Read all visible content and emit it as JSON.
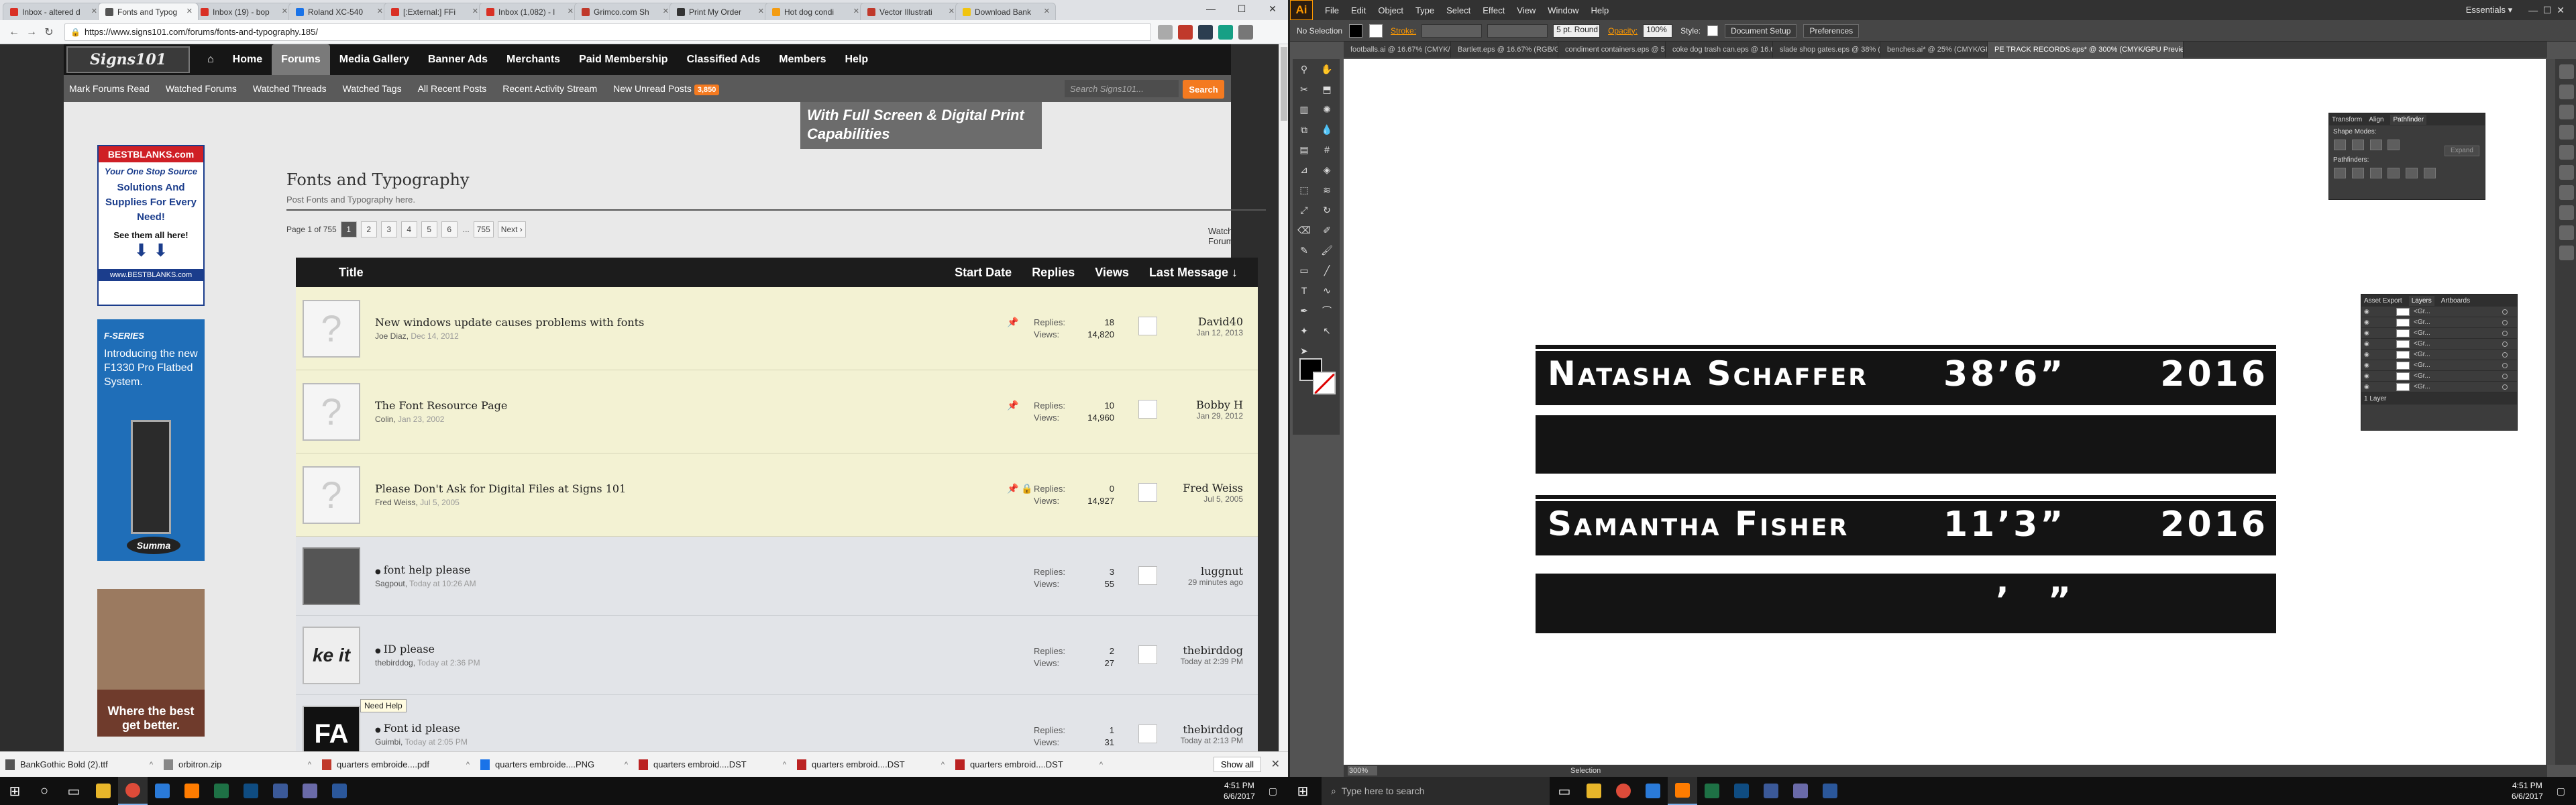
{
  "chrome": {
    "tabs": [
      {
        "label": "Inbox - altered d",
        "fav": "#d93025"
      },
      {
        "label": "Fonts and Typog",
        "fav": "#555555",
        "active": true
      },
      {
        "label": "Inbox (19) - bop",
        "fav": "#d93025"
      },
      {
        "label": "Roland XC-540",
        "fav": "#1a73e8"
      },
      {
        "label": "[:External:] FFi",
        "fav": "#d93025"
      },
      {
        "label": "Inbox (1,082) - l",
        "fav": "#d93025"
      },
      {
        "label": "Grimco.com Sh",
        "fav": "#c0392b"
      },
      {
        "label": "Print My Order",
        "fav": "#333333"
      },
      {
        "label": "Hot dog condi",
        "fav": "#f39c12"
      },
      {
        "label": "Vector Illustrati",
        "fav": "#c0392b"
      },
      {
        "label": "Download Bank",
        "fav": "#f1c40f"
      }
    ],
    "url": "https://www.signs101.com/forums/fonts-and-typography.185/",
    "downloads": [
      "BankGothic Bold (2).ttf",
      "orbitron.zip",
      "quarters embroide....pdf",
      "quarters embroide....PNG",
      "quarters embroid....DST",
      "quarters embroid....DST",
      "quarters embroid....DST"
    ],
    "show_all": "Show all"
  },
  "site": {
    "logo": "Signs101",
    "nav": [
      "Home",
      "Forums",
      "Media Gallery",
      "Banner Ads",
      "Merchants",
      "Paid Membership",
      "Classified Ads",
      "Members",
      "Help"
    ],
    "subnav": [
      "Mark Forums Read",
      "Watched Forums",
      "Watched Threads",
      "Watched Tags",
      "All Recent Posts",
      "Recent Activity Stream",
      "New Unread Posts"
    ],
    "unread_badge": "3,850",
    "search_placeholder": "Search Signs101...",
    "search_button": "Search",
    "banner_text": "With Full Screen & Digital Print Capabilities",
    "forum_title": "Fonts and Typography",
    "forum_subtitle": "Post Fonts and Typography here.",
    "pager_label": "Page 1 of 755",
    "pages": [
      "1",
      "2",
      "3",
      "4",
      "5",
      "6",
      "...",
      "755",
      "Next ›"
    ],
    "watch_forum": "Watch Forum",
    "col_title": "Title",
    "col_start": "Start Date",
    "col_replies": "Replies",
    "col_views": "Views",
    "col_last": "Last Message ↓",
    "replies_label": "Replies:",
    "views_label": "Views:",
    "threads": [
      {
        "title": "New windows update causes problems with fonts",
        "author": "Joe Diaz",
        "date": "Dec 14, 2012",
        "replies": "18",
        "views": "14,820",
        "last_user": "David40",
        "last_time": "Jan 12, 2013",
        "sticky": true
      },
      {
        "title": "The Font Resource Page",
        "author": "Colin",
        "date": "Jan 23, 2002",
        "replies": "10",
        "views": "14,960",
        "last_user": "Bobby H",
        "last_time": "Jan 29, 2012",
        "sticky": true
      },
      {
        "title": "Please Don't Ask for Digital Files at Signs 101",
        "author": "Fred Weiss",
        "date": "Jul 5, 2005",
        "replies": "0",
        "views": "14,927",
        "last_user": "Fred Weiss",
        "last_time": "Jul 5, 2005",
        "sticky": true
      },
      {
        "title": "font help please",
        "author": "Sagpout",
        "date": "Today at 10:26 AM",
        "replies": "3",
        "views": "55",
        "last_user": "luggnut",
        "last_time": "29 minutes ago",
        "sticky": false
      },
      {
        "title": "ID please",
        "author": "thebirddog",
        "date": "Today at 2:36 PM",
        "replies": "2",
        "views": "27",
        "last_user": "thebirddog",
        "last_time": "Today at 2:39 PM",
        "sticky": false
      },
      {
        "title": "Font id please",
        "author": "Guimbi",
        "date": "Today at 2:05 PM",
        "replies": "1",
        "views": "31",
        "last_user": "thebirddog",
        "last_time": "Today at 2:13 PM",
        "sticky": false
      }
    ],
    "tooltip": "Need Help",
    "ad1": {
      "header": "BESTBLANKS.com",
      "line1": "Your One Stop Source",
      "line2": "Solutions And Supplies For Every Need!",
      "line3": "See them all here!",
      "footer": "www.BESTBLANKS.com"
    },
    "ad2": {
      "series": "F-SERIES",
      "text": "Introducing the new F1330 Pro Flatbed System.",
      "brand": "Summa"
    },
    "ad3": {
      "text": "Where the best get better."
    }
  },
  "illustrator": {
    "menu": [
      "File",
      "Edit",
      "Object",
      "Type",
      "Select",
      "Effect",
      "View",
      "Window",
      "Help"
    ],
    "essentials": "Essentials ▾",
    "ctrl": {
      "selection": "No Selection",
      "stroke_label": "Stroke:",
      "brush": "5 pt. Round",
      "opacity_label": "Opacity:",
      "opacity": "100%",
      "style_label": "Style:",
      "doc_setup": "Document Setup",
      "prefs": "Preferences"
    },
    "doc_tabs": [
      "footballs.ai @ 16.67% (CMYK/GPU P...",
      "Bartlett.eps @ 16.67% (RGB/GPU Pre...",
      "condiment containers.eps @ 50% (C...",
      "coke dog trash can.eps @ 16.67% (...",
      "slade shop gates.eps @ 38% (CMYK/...",
      "benches.ai* @ 25% (CMYK/GPU Pre...",
      "PE TRACK RECORDS.eps* @ 300% (CMYK/GPU Preview)"
    ],
    "pathfinder": {
      "tabs": [
        "Transform",
        "Align",
        "Pathfinder"
      ],
      "shape_modes": "Shape Modes:",
      "pathfinders": "Pathfinders:",
      "expand": "Expand"
    },
    "layers": {
      "tabs": [
        "Asset Export",
        "Layers",
        "Artboards"
      ],
      "footer": "1 Layer",
      "rows": [
        "<Gr...",
        "<Gr...",
        "<Gr...",
        "<Gr...",
        "<Gr...",
        "<Gr...",
        "<Gr...",
        "<Gr..."
      ]
    },
    "artwork": [
      {
        "name": "Natasha Schaffer",
        "measure": "38’6”",
        "year": "2016"
      },
      {
        "name": "",
        "measure": "",
        "year": ""
      },
      {
        "name": "Samantha Fisher",
        "measure": "11’3”",
        "year": "2016"
      },
      {
        "name": "",
        "measure": "’ ”",
        "year": ""
      }
    ],
    "zoom": "300%",
    "status": "Selection"
  },
  "taskbar": {
    "left_time": "4:51 PM",
    "left_date": "6/6/2017",
    "right_time": "4:51 PM",
    "right_date": "6/6/2017",
    "search_placeholder": "Type here to search"
  }
}
